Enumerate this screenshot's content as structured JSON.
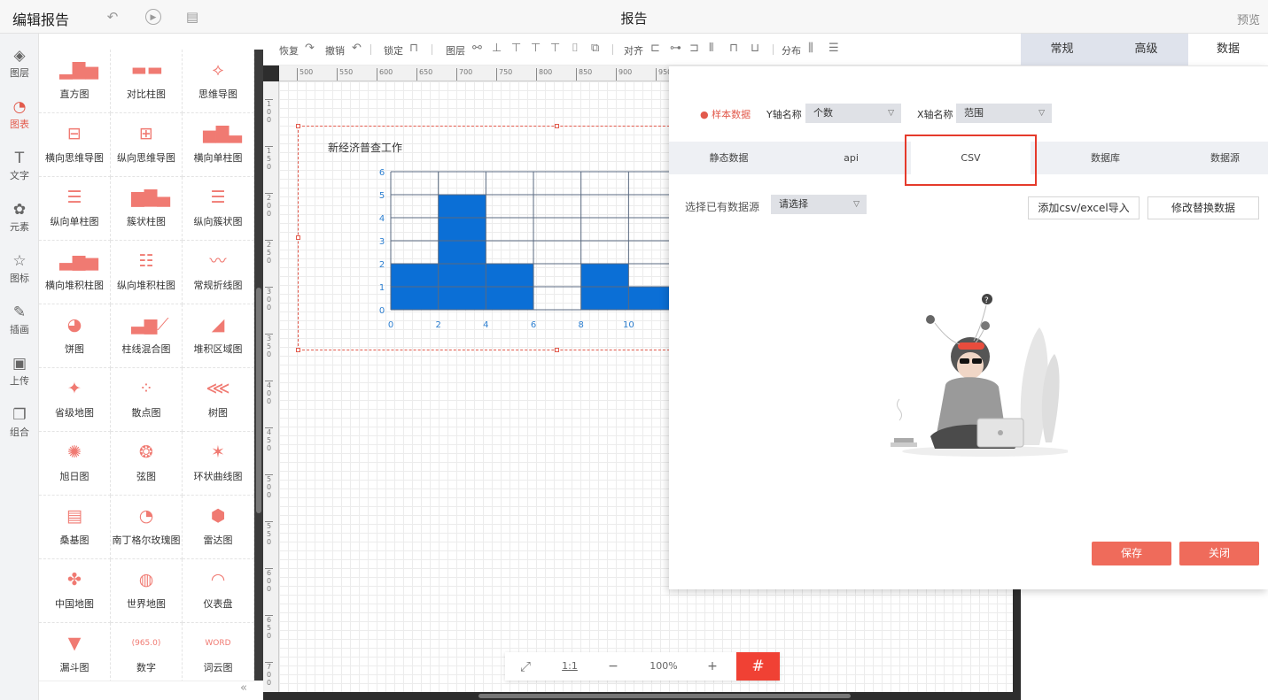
{
  "header": {
    "app_title": "编辑报告",
    "report_title": "报告",
    "preview_label": "预览"
  },
  "iconbar": [
    {
      "label": "图层",
      "icon": "layers-icon",
      "glyph": "◈"
    },
    {
      "label": "图表",
      "icon": "chart-icon",
      "glyph": "◔"
    },
    {
      "label": "文字",
      "icon": "text-icon",
      "glyph": "T"
    },
    {
      "label": "元素",
      "icon": "elements-icon",
      "glyph": "✿"
    },
    {
      "label": "图标",
      "icon": "star-icon",
      "glyph": "☆"
    },
    {
      "label": "插画",
      "icon": "palette-icon",
      "glyph": "✎"
    },
    {
      "label": "上传",
      "icon": "image-upload-icon",
      "glyph": "▣"
    },
    {
      "label": "组合",
      "icon": "group-icon",
      "glyph": "❐"
    }
  ],
  "palette": [
    {
      "label": "直方图",
      "glyph": "▂▇▅"
    },
    {
      "label": "对比柱图",
      "glyph": "▬▬"
    },
    {
      "label": "思维导图",
      "glyph": "⟡"
    },
    {
      "label": "横向思维导图",
      "glyph": "⊟"
    },
    {
      "label": "纵向思维导图",
      "glyph": "⊞"
    },
    {
      "label": "横向单柱图",
      "glyph": "▅▇▃"
    },
    {
      "label": "纵向单柱图",
      "glyph": "☰"
    },
    {
      "label": "簇状柱图",
      "glyph": "▆▇▄"
    },
    {
      "label": "纵向簇状图",
      "glyph": "☰"
    },
    {
      "label": "横向堆积柱图",
      "glyph": "▃▆▅"
    },
    {
      "label": "纵向堆积柱图",
      "glyph": "☷"
    },
    {
      "label": "常规折线图",
      "glyph": "〰"
    },
    {
      "label": "饼图",
      "glyph": "◕"
    },
    {
      "label": "柱线混合图",
      "glyph": "▃▆⟋"
    },
    {
      "label": "堆积区域图",
      "glyph": "◢"
    },
    {
      "label": "省级地图",
      "glyph": "✦"
    },
    {
      "label": "散点图",
      "glyph": "⁘"
    },
    {
      "label": "树图",
      "glyph": "⋘"
    },
    {
      "label": "旭日图",
      "glyph": "✺"
    },
    {
      "label": "弦图",
      "glyph": "❂"
    },
    {
      "label": "环状曲线图",
      "glyph": "✶"
    },
    {
      "label": "桑基图",
      "glyph": "▤"
    },
    {
      "label": "南丁格尔玫瑰图",
      "glyph": "◔"
    },
    {
      "label": "雷达图",
      "glyph": "⬢"
    },
    {
      "label": "中国地图",
      "glyph": "✤"
    },
    {
      "label": "世界地图",
      "glyph": "◍"
    },
    {
      "label": "仪表盘",
      "glyph": "◠"
    },
    {
      "label": "漏斗图",
      "glyph": "▼"
    },
    {
      "label": "数字",
      "glyph": "(965.0)"
    },
    {
      "label": "词云图",
      "glyph": "WORD"
    }
  ],
  "toolbar": {
    "redo": "恢复",
    "undo": "撤销",
    "lock": "锁定",
    "layer": "图层",
    "align": "对齐",
    "distribute": "分布"
  },
  "ruler": {
    "h_ticks": [
      "500",
      "550",
      "600",
      "650",
      "700",
      "750",
      "800",
      "850",
      "900",
      "950"
    ],
    "v_ticks": [
      "100",
      "150",
      "200",
      "250",
      "300",
      "350",
      "400",
      "450",
      "500",
      "550",
      "600",
      "650",
      "700"
    ]
  },
  "chart": {
    "title": "新经济普查工作"
  },
  "chart_data": {
    "type": "bar",
    "title": "新经济普查工作",
    "x_ticks": [
      "0",
      "2",
      "4",
      "6",
      "8",
      "10"
    ],
    "y_ticks": [
      "0",
      "1",
      "2",
      "3",
      "4",
      "5",
      "6"
    ],
    "bins": [
      [
        0,
        2
      ],
      [
        2,
        4
      ],
      [
        4,
        6
      ],
      [
        6,
        8
      ],
      [
        8,
        10
      ],
      [
        10,
        12
      ]
    ],
    "values": [
      2,
      5,
      2,
      0,
      2,
      1
    ],
    "ylim": [
      0,
      6
    ],
    "xlim": [
      0,
      12
    ],
    "bar_color": "#0b6fd6",
    "grid": true
  },
  "zoom": {
    "fit_label": "⤢",
    "ratio_label": "1:1",
    "minus": "−",
    "percent": "100%",
    "plus": "+",
    "grid_icon": "#"
  },
  "right_tabs": [
    {
      "label": "常规"
    },
    {
      "label": "高级"
    },
    {
      "label": "数据"
    }
  ],
  "dialog": {
    "sample_label": "● 样本数据",
    "y_axis_label": "Y轴名称",
    "y_axis_value": "个数",
    "x_axis_label": "X轴名称",
    "x_axis_value": "范围",
    "source_tabs": [
      "静态数据",
      "api",
      "CSV",
      "数据库",
      "数据源"
    ],
    "choose_label": "选择已有数据源",
    "choose_value": "请选择",
    "add_csv": "添加csv/excel导入",
    "modify_data": "修改替换数据",
    "save": "保存",
    "close": "关闭"
  },
  "colors": {
    "accent": "#e25a4c",
    "bar": "#0b6fd6",
    "button_red": "#ef6b5b",
    "highlight": "#e53a2b"
  }
}
